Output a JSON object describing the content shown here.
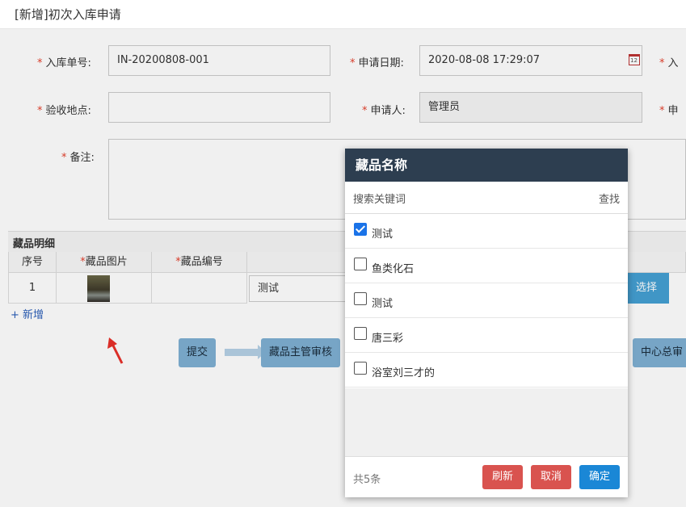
{
  "window": {
    "title": "[新增]初次入库申请"
  },
  "form": {
    "entry_no_label": "入库单号:",
    "entry_no_value": "IN-20200808-001",
    "apply_date_label": "申请日期:",
    "apply_date_value": "2020-08-08 17:29:07",
    "right_col_label_1": "入",
    "inspect_place_label": "验收地点:",
    "inspect_place_value": "",
    "applicant_label": "申请人:",
    "applicant_value": "管理员",
    "right_col_label_2": "申",
    "remark_label": "备注:",
    "required_mark": "*"
  },
  "detail": {
    "title": "藏品明细",
    "columns": [
      "序号",
      "藏品图片",
      "藏品编号"
    ],
    "row": {
      "index": "1",
      "name_value": "测试"
    },
    "add_row": "+ 新增",
    "select_button": "选择"
  },
  "flow": {
    "steps": [
      "提交",
      "藏品主管审核",
      "中心总审"
    ]
  },
  "modal": {
    "title": "藏品名称",
    "search_placeholder": "搜索关键词",
    "search_button": "查找",
    "items": [
      {
        "label": "测试",
        "checked": true
      },
      {
        "label": "鱼类化石",
        "checked": false
      },
      {
        "label": "测试",
        "checked": false
      },
      {
        "label": "唐三彩",
        "checked": false
      },
      {
        "label": "浴室刘三才的",
        "checked": false
      }
    ],
    "total": "共5条",
    "refresh_button": "刷新",
    "cancel_button": "取消",
    "ok_button": "确定"
  },
  "colors": {
    "modal_header": "#2d3e50",
    "danger": "#d9534f",
    "primary": "#1a87d6",
    "flow_step": "#7fb0d3",
    "required": "#e5412d"
  },
  "icons": [
    "calendar-icon",
    "checkbox-icon",
    "red-arrow-annotation"
  ]
}
